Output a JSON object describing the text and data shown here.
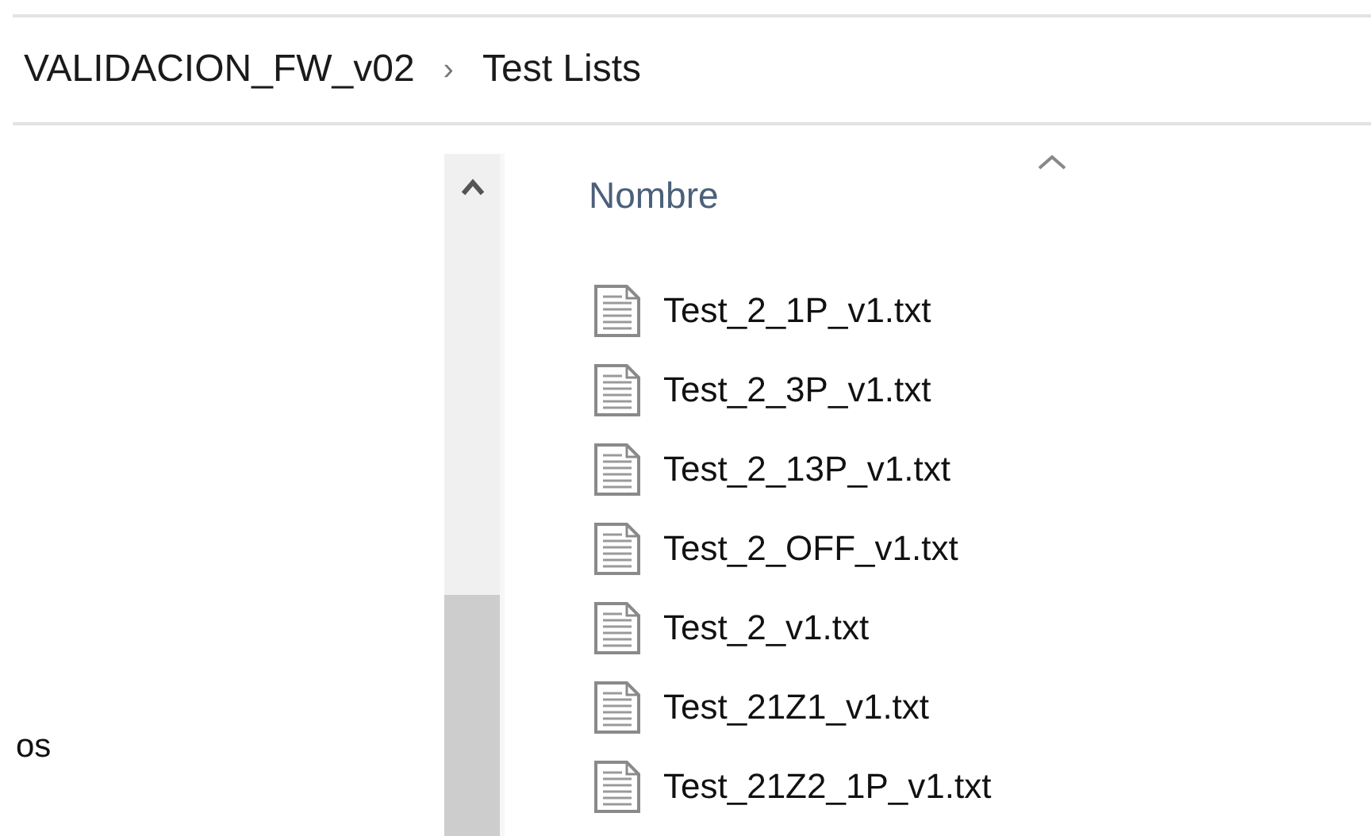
{
  "breadcrumb": {
    "items": [
      "VALIDACION_FW_v02",
      "Test Lists"
    ],
    "separator": "›"
  },
  "navigation_pane": {
    "partial_label": "os"
  },
  "file_list": {
    "column": {
      "label": "Nombre",
      "sorted_ascending": true
    },
    "files": [
      {
        "name": "Test_2_1P_v1.txt"
      },
      {
        "name": "Test_2_3P_v1.txt"
      },
      {
        "name": "Test_2_13P_v1.txt"
      },
      {
        "name": "Test_2_OFF_v1.txt"
      },
      {
        "name": "Test_2_v1.txt"
      },
      {
        "name": "Test_21Z1_v1.txt"
      },
      {
        "name": "Test_21Z2_1P_v1.txt"
      }
    ]
  }
}
